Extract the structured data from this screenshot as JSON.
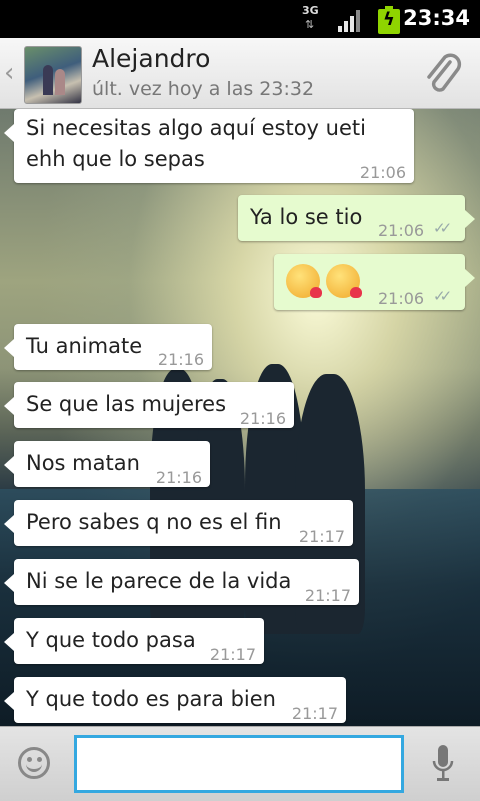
{
  "status_bar": {
    "network_type": "3G",
    "time": "23:34"
  },
  "header": {
    "contact_name": "Alejandro",
    "last_seen": "últ. vez hoy a las 23:32"
  },
  "messages": [
    {
      "direction": "in",
      "lines": [
        "Si necesitas algo aquí estoy ueti",
        "ehh que lo sepas"
      ],
      "time": "21:06"
    },
    {
      "direction": "out",
      "text": "Ya lo se tio",
      "time": "21:06",
      "status": "read"
    },
    {
      "direction": "out",
      "emoji": [
        "kissing-face-emoji",
        "kissing-face-emoji"
      ],
      "time": "21:06",
      "status": "read"
    },
    {
      "direction": "in",
      "text": "Tu animate",
      "time": "21:16"
    },
    {
      "direction": "in",
      "text": "Se que las mujeres",
      "time": "21:16"
    },
    {
      "direction": "in",
      "text": "Nos matan",
      "time": "21:16"
    },
    {
      "direction": "in",
      "text": "Pero sabes q no es el fin",
      "time": "21:17"
    },
    {
      "direction": "in",
      "text": "Ni se le parece de la vida",
      "time": "21:17"
    },
    {
      "direction": "in",
      "text": "Y que todo pasa",
      "time": "21:17"
    },
    {
      "direction": "in",
      "text": "Y que todo es para bien",
      "time": "21:17"
    }
  ],
  "input_bar": {
    "message_value": "",
    "placeholder": ""
  },
  "colors": {
    "incoming_bubble": "#ffffff",
    "outgoing_bubble": "#e6fbcf",
    "input_focus_border": "#34a8e0",
    "battery": "#8fd400"
  }
}
